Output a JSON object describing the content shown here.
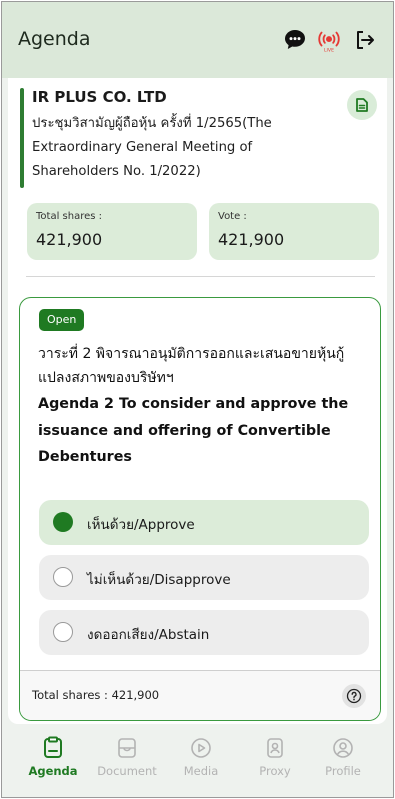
{
  "header": {
    "title": "Agenda",
    "icons": [
      "chat-icon",
      "live-icon",
      "logout-icon"
    ],
    "live_text": "LIVE"
  },
  "company": {
    "name": "IR PLUS CO. LTD",
    "meeting_title": "ประชุมวิสามัญผู้ถือหุ้น ครั้งที่ 1/2565(The Extraordinary General Meeting of Shareholders No. 1/2022)"
  },
  "shares": {
    "total_label": "Total shares :",
    "total_value": "421,900",
    "vote_label": "Vote :",
    "vote_value": "421,900"
  },
  "agenda": {
    "status": "Open",
    "title_th": "วาระที่ 2 พิจารณาอนุมัติการออกและเสนอขายหุ้นกู้แปลงสภาพของบริษัทฯ",
    "title_en": "Agenda 2 To consider and approve the issuance and offering of Convertible Debentures",
    "options": [
      {
        "label": "เห็นด้วย/Approve",
        "selected": true
      },
      {
        "label": "ไม่เห็นด้วย/Disapprove",
        "selected": false
      },
      {
        "label": "งดออกเสียง/Abstain",
        "selected": false
      }
    ],
    "footer_shares": "Total shares : 421,900"
  },
  "nav": {
    "items": [
      {
        "label": "Agenda",
        "icon": "agenda-icon",
        "active": true
      },
      {
        "label": "Document",
        "icon": "document-icon",
        "active": false
      },
      {
        "label": "Media",
        "icon": "media-icon",
        "active": false
      },
      {
        "label": "Proxy",
        "icon": "proxy-icon",
        "active": false
      },
      {
        "label": "Profile",
        "icon": "profile-icon",
        "active": false
      }
    ]
  },
  "colors": {
    "accent": "#1f7a22",
    "header_bg": "#dbe8d9",
    "live_red": "#e53935"
  }
}
